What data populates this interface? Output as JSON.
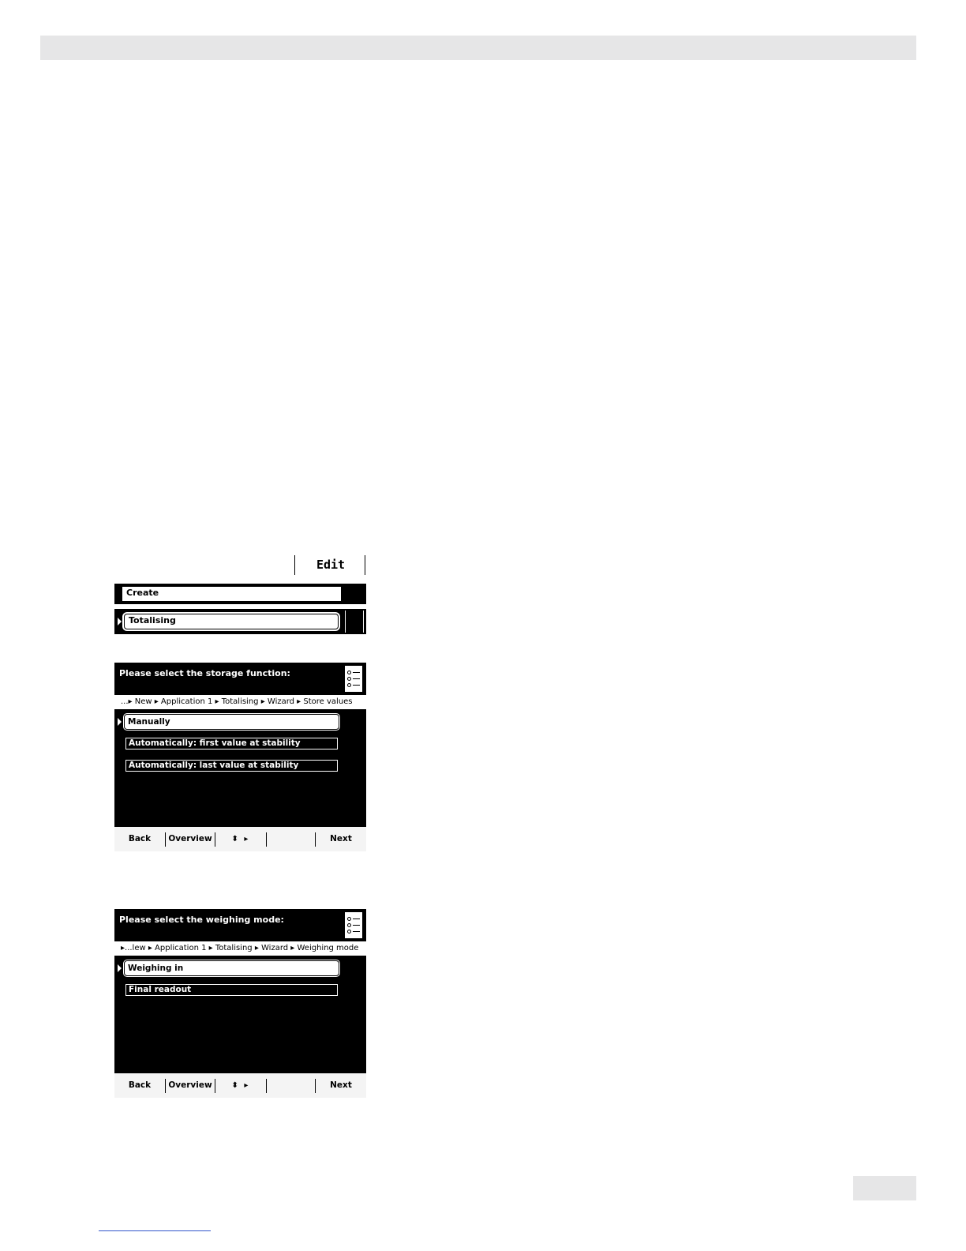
{
  "screen1": {
    "edit_label": "Edit",
    "rows": [
      {
        "label": "Create",
        "selected": false
      },
      {
        "label": "Totalising",
        "selected": true
      }
    ]
  },
  "screen2": {
    "title": "Please select the storage function:",
    "breadcrumb": "...▸ New ▸ Application 1 ▸ Totalising ▸ Wizard ▸ Store values",
    "options": [
      {
        "label": "Manually",
        "selected": true
      },
      {
        "label": "Automatically: first value at stability",
        "selected": false
      },
      {
        "label": "Automatically: last value at stability",
        "selected": false
      }
    ],
    "softkeys": {
      "back": "Back",
      "overview": "Overview",
      "arrows": "⬍ ▸",
      "next": "Next"
    }
  },
  "screen3": {
    "title": "Please select the weighing mode:",
    "breadcrumb": "▸...lew ▸ Application 1 ▸ Totalising ▸ Wizard ▸ Weighing mode",
    "options": [
      {
        "label": "Weighing in",
        "selected": true
      },
      {
        "label": "Final readout",
        "selected": false
      }
    ],
    "softkeys": {
      "back": "Back",
      "overview": "Overview",
      "arrows": "⬍ ▸",
      "next": "Next"
    }
  }
}
